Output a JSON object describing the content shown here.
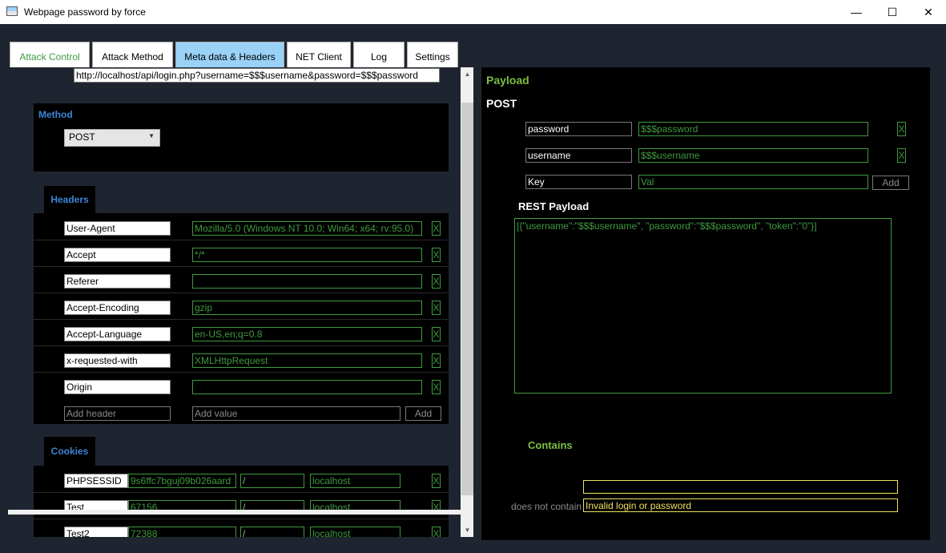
{
  "window": {
    "title": "Webpage password by force",
    "min": "—",
    "max": "☐",
    "close": "✕"
  },
  "tabs": [
    {
      "label": "Attack Control"
    },
    {
      "label": "Attack Method"
    },
    {
      "label": "Meta data & Headers"
    },
    {
      "label": "NET Client"
    },
    {
      "label": "Log"
    },
    {
      "label": "Settings"
    }
  ],
  "url": "http://localhost/api/login.php?username=$$$username&password=$$$password",
  "method": {
    "label": "Method",
    "value": "POST"
  },
  "headers": {
    "title": "Headers",
    "rows": [
      {
        "key": "User-Agent",
        "value": "Mozilla/5.0 (Windows NT 10.0; Win64; x64; rv:95.0)"
      },
      {
        "key": "Accept",
        "value": "*/*"
      },
      {
        "key": "Referer",
        "value": ""
      },
      {
        "key": "Accept-Encoding",
        "value": "gzip"
      },
      {
        "key": "Accept-Language",
        "value": "en-US,en;q=0.8"
      },
      {
        "key": "x-requested-with",
        "value": "XMLHttpRequest"
      },
      {
        "key": "Origin",
        "value": ""
      }
    ],
    "add_key_placeholder": "Add header",
    "add_value_placeholder": "Add value",
    "add_label": "Add",
    "remove_label": "X"
  },
  "cookies": {
    "title": "Cookies",
    "rows": [
      {
        "name": "PHPSESSID",
        "value": "9s6ffc7bguj09b026aard",
        "path": "/",
        "domain": "localhost"
      },
      {
        "name": "Test",
        "value": "67156",
        "path": "/",
        "domain": "localhost"
      },
      {
        "name": "Test2",
        "value": "72388",
        "path": "/",
        "domain": "localhost"
      }
    ]
  },
  "payload": {
    "title": "Payload",
    "method": "POST",
    "rows": [
      {
        "key": "password",
        "value": "$$$password"
      },
      {
        "key": "username",
        "value": "$$$username"
      }
    ],
    "new_key": "Key",
    "new_value": "Val",
    "add_label": "Add",
    "remove_label": "X",
    "rest_title": "REST Payload",
    "rest_body": "[{\"username\":\"$$$username\", \"password\":\"$$$password\", \"token\":\"0\"}]"
  },
  "contains": {
    "title": "Contains",
    "contains_value": "",
    "not_contains_label": "does not contain",
    "not_contains_value": "Invalid login or password"
  },
  "colors": {
    "accent_blue": "#3a86d6",
    "accent_green": "#7cbe40",
    "value_green": "#3f9a3f",
    "yellow": "#f0e060",
    "active_tab": "#99d1f7"
  }
}
